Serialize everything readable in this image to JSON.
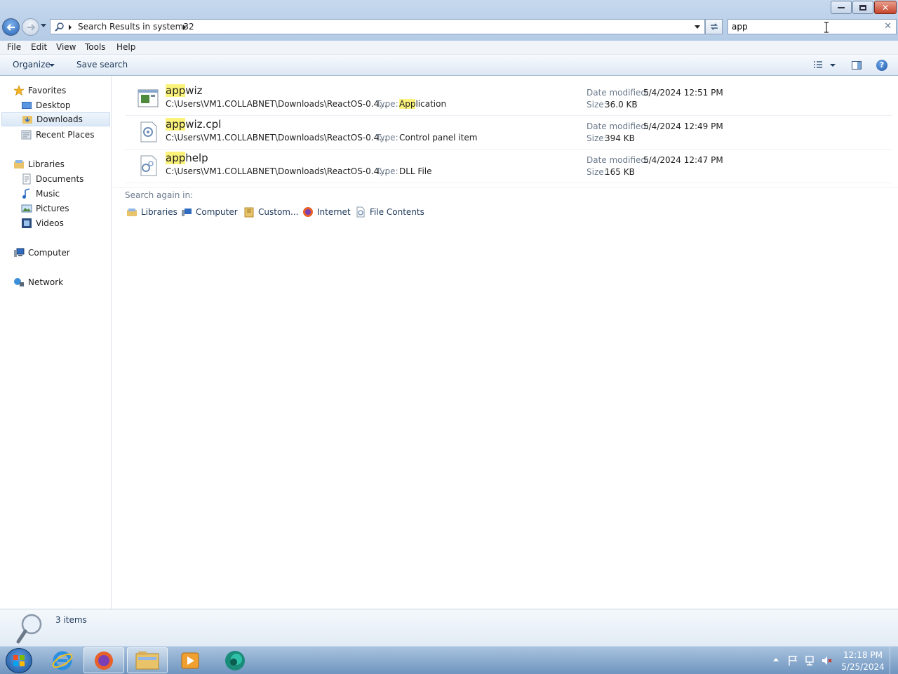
{
  "window": {
    "minimize_label": "–",
    "close_label": "✕"
  },
  "address": {
    "breadcrumb": "Search Results in system32"
  },
  "search": {
    "value": "app",
    "clear_label": "✕"
  },
  "menu": [
    "File",
    "Edit",
    "View",
    "Tools",
    "Help"
  ],
  "commands": {
    "organize": "Organize",
    "save_search": "Save search"
  },
  "nav": {
    "favorites": "Favorites",
    "desktop": "Desktop",
    "downloads": "Downloads",
    "recent_places": "Recent Places",
    "libraries": "Libraries",
    "documents": "Documents",
    "music": "Music",
    "pictures": "Pictures",
    "videos": "Videos",
    "computer": "Computer",
    "network": "Network"
  },
  "results": [
    {
      "name_match": "app",
      "name_rest": "wiz",
      "path": "C:\\Users\\VM1.COLLABNET\\Downloads\\ReactOS-0.4...",
      "type_label": "Type:",
      "type_match": "App",
      "type_rest": "lication",
      "date_label": "Date modified:",
      "date": "5/4/2024 12:51 PM",
      "size_label": "Size:",
      "size": "36.0 KB",
      "icon": "application-icon"
    },
    {
      "name_match": "app",
      "name_rest": "wiz.cpl",
      "path": "C:\\Users\\VM1.COLLABNET\\Downloads\\ReactOS-0.4...",
      "type_label": "Type:",
      "type_match": "",
      "type_rest": "Control panel item",
      "date_label": "Date modified:",
      "date": "5/4/2024 12:49 PM",
      "size_label": "Size:",
      "size": "394 KB",
      "icon": "control-panel-item-icon"
    },
    {
      "name_match": "app",
      "name_rest": "help",
      "path": "C:\\Users\\VM1.COLLABNET\\Downloads\\ReactOS-0.4...",
      "type_label": "Type:",
      "type_match": "",
      "type_rest": "DLL File",
      "date_label": "Date modified:",
      "date": "5/4/2024 12:47 PM",
      "size_label": "Size:",
      "size": "165 KB",
      "icon": "dll-file-icon"
    }
  ],
  "search_again": {
    "title": "Search again in:",
    "items": [
      "Libraries",
      "Computer",
      "Custom...",
      "Internet",
      "File Contents"
    ]
  },
  "details": {
    "count": "3 items"
  },
  "taskbar": {
    "time": "12:18 PM",
    "date": "5/25/2024"
  },
  "colors": {
    "highlight": "#fbf27a",
    "titlebar": "#c5d8ee",
    "taskbar": "#6f95bf"
  }
}
